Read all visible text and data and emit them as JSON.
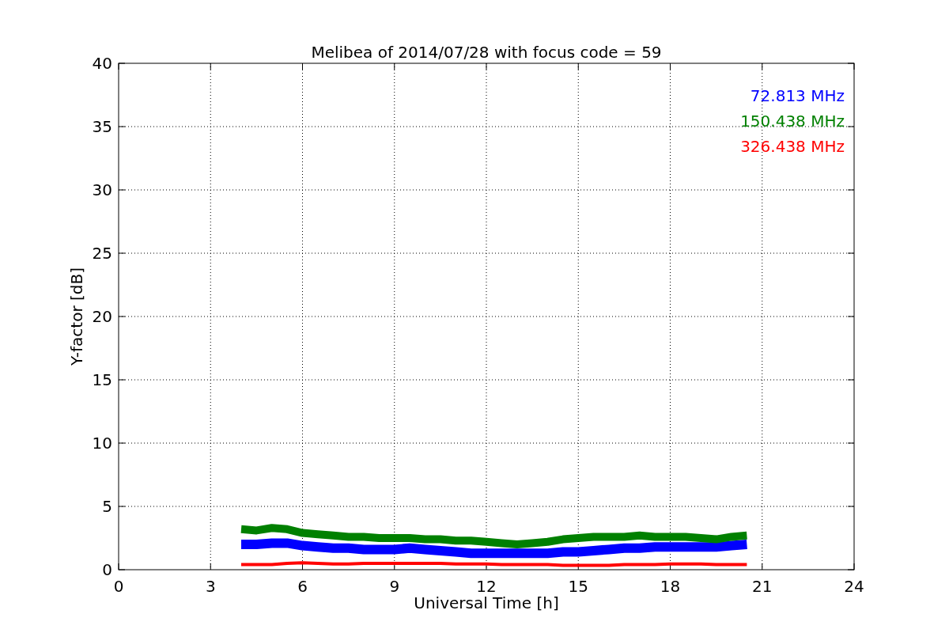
{
  "plot": {
    "chart_data": {
      "type": "line",
      "title": "Melibea of 2014/07/28 with focus code = 59",
      "xlabel": "Universal Time [h]",
      "ylabel": "Y-factor [dB]",
      "x": [
        4,
        4.5,
        5,
        5.5,
        6,
        6.5,
        7,
        7.5,
        8,
        8.5,
        9,
        9.5,
        10,
        10.5,
        11,
        11.5,
        12,
        12.5,
        13,
        13.5,
        14,
        14.5,
        15,
        15.5,
        16,
        16.5,
        17,
        17.5,
        18,
        18.5,
        19,
        19.5,
        20,
        20.5
      ],
      "series": [
        {
          "name": "72.813 MHz",
          "color": "#0000ff",
          "values": [
            2.0,
            2.0,
            2.1,
            2.1,
            1.9,
            1.8,
            1.7,
            1.7,
            1.6,
            1.6,
            1.6,
            1.7,
            1.6,
            1.5,
            1.4,
            1.3,
            1.3,
            1.3,
            1.3,
            1.3,
            1.3,
            1.4,
            1.4,
            1.5,
            1.6,
            1.7,
            1.7,
            1.8,
            1.8,
            1.8,
            1.8,
            1.8,
            1.9,
            2.0
          ]
        },
        {
          "name": "150.438 MHz",
          "color": "#008000",
          "values": [
            3.2,
            3.1,
            3.3,
            3.2,
            2.9,
            2.8,
            2.7,
            2.6,
            2.6,
            2.5,
            2.5,
            2.5,
            2.4,
            2.4,
            2.3,
            2.3,
            2.2,
            2.1,
            2.0,
            2.1,
            2.2,
            2.4,
            2.5,
            2.6,
            2.6,
            2.6,
            2.7,
            2.6,
            2.6,
            2.6,
            2.5,
            2.4,
            2.6,
            2.7
          ]
        },
        {
          "name": "326.438 MHz",
          "color": "#ff0000",
          "values": [
            0.4,
            0.4,
            0.4,
            0.5,
            0.55,
            0.5,
            0.45,
            0.45,
            0.5,
            0.5,
            0.5,
            0.5,
            0.5,
            0.5,
            0.45,
            0.45,
            0.45,
            0.4,
            0.4,
            0.4,
            0.4,
            0.35,
            0.35,
            0.35,
            0.35,
            0.4,
            0.4,
            0.4,
            0.45,
            0.45,
            0.45,
            0.4,
            0.4,
            0.4
          ]
        }
      ],
      "xlim": [
        0,
        24
      ],
      "ylim": [
        0,
        40
      ],
      "xticks": [
        0,
        3,
        6,
        9,
        12,
        15,
        18,
        21,
        24
      ],
      "yticks": [
        0,
        5,
        10,
        15,
        20,
        25,
        30,
        35,
        40
      ],
      "grid": true
    }
  }
}
